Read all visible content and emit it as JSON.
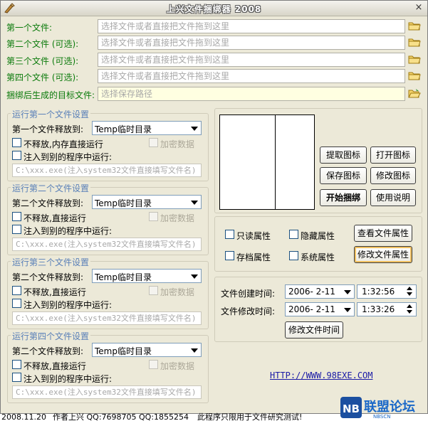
{
  "window": {
    "title": "上兴文件捆绑器 2008",
    "close_glyph": "×"
  },
  "files": [
    {
      "label": "第一个文件:",
      "placeholder": "选择文件或者直接把文件拖到这里"
    },
    {
      "label": "第二个文件 (可选):",
      "placeholder": "选择文件或者直接把文件拖到这里"
    },
    {
      "label": "第三个文件 (可选):",
      "placeholder": "选择文件或者直接把文件拖到这里"
    },
    {
      "label": "第四个文件 (可选):",
      "placeholder": "选择文件或者直接把文件拖到这里"
    }
  ],
  "target": {
    "label": "捆绑后生成的目标文件:",
    "placeholder": "选择保存路径"
  },
  "groups": [
    {
      "title": "运行第一个文件设置",
      "release_label": "第一个文件释放到:",
      "release_value": "Temp临时目录",
      "no_release": "不释放,内存直接运行",
      "encrypt": "加密数据",
      "inject": "注入到别的程序中运行:",
      "inject_placeholder": "C:\\xxx.exe(注入system32文件直接填写文件名)"
    },
    {
      "title": "运行第二个文件设置",
      "release_label": "第二个文件释放到:",
      "release_value": "Temp临时目录",
      "no_release": "不释放,直接运行",
      "encrypt": "加密数据",
      "inject": "注入到别的程序中运行:",
      "inject_placeholder": "C:\\xxx.exe(注入system32文件直接填写文件名)"
    },
    {
      "title": "运行第三个文件设置",
      "release_label": "第二个文件释放到:",
      "release_value": "Temp临时目录",
      "no_release": "不释放,直接运行",
      "encrypt": "加密数据",
      "inject": "注入到别的程序中运行:",
      "inject_placeholder": "C:\\xxx.exe(注入system32文件直接填写文件名)"
    },
    {
      "title": "运行第四个文件设置",
      "release_label": "第二个文件释放到:",
      "release_value": "Temp临时目录",
      "no_release": "不释放,直接运行",
      "encrypt": "加密数据",
      "inject": "注入到别的程序中运行:",
      "inject_placeholder": "C:\\xxx.exe(注入system32文件直接填写文件名)"
    }
  ],
  "icon_buttons": {
    "extract": "提取图标",
    "open": "打开图标",
    "save": "保存图标",
    "modify": "修改图标",
    "start": "开始捆绑",
    "help": "使用说明"
  },
  "attributes": {
    "readonly": "只读属性",
    "hidden": "隐藏属性",
    "archive": "存档属性",
    "system": "系统属性",
    "view_button": "查看文件属性",
    "modify_button": "修改文件属性"
  },
  "filetime": {
    "created_label": "文件创建时间:",
    "created_date": "2006- 2-11",
    "created_time": "1:32:56",
    "modified_label": "文件修改时间:",
    "modified_date": "2006- 2-11",
    "modified_time": "1:33:26",
    "modify_button": "修改文件时间"
  },
  "link": "HTTP://WWW.98EXE.COM",
  "status": {
    "date": "2008.11.20",
    "author": "作者上兴 QQ:7698705 QQ:1855254",
    "notice": "此程序只限用于文件研究测试!"
  },
  "watermark": {
    "badge": "NB",
    "text": "联盟论坛",
    "sub": "NBSCN"
  },
  "icons": [
    "app-icon",
    "close-icon",
    "folder-icon",
    "folder-open-icon",
    "dropdown-arrow-icon",
    "spin-icon"
  ],
  "colors": {
    "label_green": "#0a7a0a",
    "group_title_blue": "#5a80b8",
    "window_bg": "#ece9d8",
    "link_blue": "#1a1aa6"
  }
}
